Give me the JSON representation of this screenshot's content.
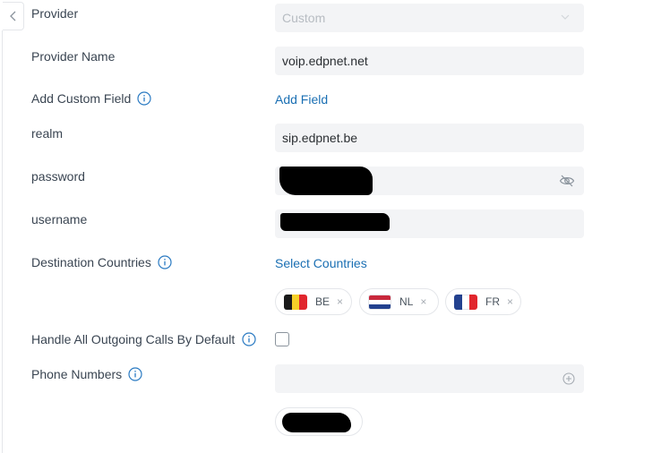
{
  "form": {
    "provider": {
      "label": "Provider",
      "value": "Custom"
    },
    "provider_name": {
      "label": "Provider Name",
      "value": "voip.edpnet.net"
    },
    "custom_field": {
      "label": "Add Custom Field",
      "link": "Add Field"
    },
    "realm": {
      "label": "realm",
      "value": "sip.edpnet.be"
    },
    "password": {
      "label": "password"
    },
    "username": {
      "label": "username"
    },
    "destination": {
      "label": "Destination Countries",
      "link": "Select Countries",
      "chips": [
        {
          "code": "BE",
          "colors": [
            "#1a1a1a",
            "#f5d028",
            "#e1262d"
          ]
        },
        {
          "code": "NL",
          "colors": [
            "#c8283c",
            "#ffffff",
            "#23418f"
          ]
        },
        {
          "code": "FR",
          "colors": [
            "#23418f",
            "#ffffff",
            "#e1262d"
          ]
        }
      ]
    },
    "outgoing": {
      "label": "Handle All Outgoing Calls By Default",
      "checked": false
    },
    "phone_numbers": {
      "label": "Phone Numbers"
    }
  },
  "colors": {
    "link": "#1a6fb3",
    "field_bg": "#f3f4f6",
    "info_icon": "#2a7ac2"
  },
  "icons": [
    "chevron-left-icon",
    "chevron-down-icon",
    "info-icon",
    "eye-off-icon",
    "plus-circle-icon",
    "close-icon"
  ]
}
